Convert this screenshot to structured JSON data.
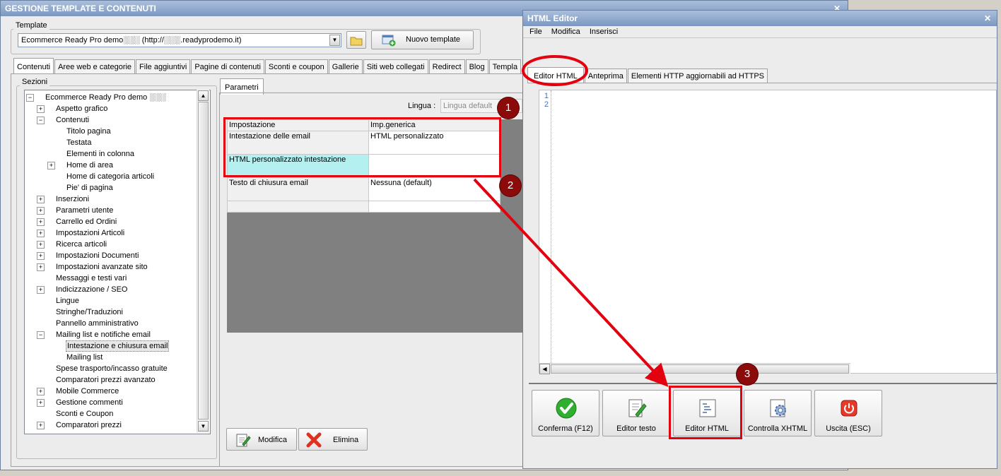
{
  "main": {
    "title": "GESTIONE TEMPLATE E CONTENUTI",
    "template_group_label": "Template",
    "template_select_value": "Ecommerce Ready Pro demo░░░ (http://░░░.readyprodemo.it)",
    "new_template_label": "Nuovo template",
    "tabs": [
      "Contenuti",
      "Aree web e categorie",
      "File aggiuntivi",
      "Pagine di contenuti",
      "Sconti e coupon",
      "Gallerie",
      "Siti web collegati",
      "Redirect",
      "Blog",
      "Templa"
    ],
    "sections_label": "Sezioni",
    "tree": [
      {
        "label": "Ecommerce Ready Pro demo ░░░",
        "level": 0,
        "exp": "−"
      },
      {
        "label": "Aspetto grafico",
        "level": 1,
        "exp": "+"
      },
      {
        "label": "Contenuti",
        "level": 1,
        "exp": "−"
      },
      {
        "label": "Titolo pagina",
        "level": 2,
        "exp": ""
      },
      {
        "label": "Testata",
        "level": 2,
        "exp": ""
      },
      {
        "label": "Elementi in colonna",
        "level": 2,
        "exp": ""
      },
      {
        "label": "Home di area",
        "level": 2,
        "exp": "+"
      },
      {
        "label": "Home di categoria articoli",
        "level": 2,
        "exp": ""
      },
      {
        "label": "Pie' di pagina",
        "level": 2,
        "exp": ""
      },
      {
        "label": "Inserzioni",
        "level": 1,
        "exp": "+"
      },
      {
        "label": "Parametri utente",
        "level": 1,
        "exp": "+"
      },
      {
        "label": "Carrello ed Ordini",
        "level": 1,
        "exp": "+"
      },
      {
        "label": "Impostazioni Articoli",
        "level": 1,
        "exp": "+"
      },
      {
        "label": "Ricerca articoli",
        "level": 1,
        "exp": "+"
      },
      {
        "label": "Impostazioni Documenti",
        "level": 1,
        "exp": "+"
      },
      {
        "label": "Impostazioni avanzate sito",
        "level": 1,
        "exp": "+"
      },
      {
        "label": "Messaggi e testi vari",
        "level": 1,
        "exp": ""
      },
      {
        "label": "Indicizzazione / SEO",
        "level": 1,
        "exp": "+"
      },
      {
        "label": "Lingue",
        "level": 1,
        "exp": ""
      },
      {
        "label": "Stringhe/Traduzioni",
        "level": 1,
        "exp": ""
      },
      {
        "label": "Pannello amministrativo",
        "level": 1,
        "exp": ""
      },
      {
        "label": "Mailing list e notifiche email",
        "level": 1,
        "exp": "−"
      },
      {
        "label": "Intestazione e chiusura email",
        "level": 2,
        "exp": "",
        "selected": true
      },
      {
        "label": "Mailing list",
        "level": 2,
        "exp": ""
      },
      {
        "label": "Spese trasporto/incasso gratuite",
        "level": 1,
        "exp": ""
      },
      {
        "label": "Comparatori prezzi avanzato",
        "level": 1,
        "exp": ""
      },
      {
        "label": "Mobile Commerce",
        "level": 1,
        "exp": "+"
      },
      {
        "label": "Gestione commenti",
        "level": 1,
        "exp": "+"
      },
      {
        "label": "Sconti e Coupon",
        "level": 1,
        "exp": ""
      },
      {
        "label": "Comparatori prezzi",
        "level": 1,
        "exp": "+"
      }
    ],
    "params_tab": "Parametri",
    "lingua_label": "Lingua :",
    "lingua_placeholder": "Lingua default",
    "grid_headers": [
      "Impostazione",
      "Imp.generica"
    ],
    "grid_rows": [
      {
        "name": "Intestazione delle email",
        "value": "HTML personalizzato"
      },
      {
        "name": "HTML personalizzato intestazione",
        "value": "",
        "selected": true
      },
      {
        "name": "Testo di chiusura email",
        "value": "Nessuna (default)"
      }
    ],
    "modifica_label": "Modifica",
    "elimina_label": "Elimina"
  },
  "editor": {
    "title": "HTML Editor",
    "menu": [
      "File",
      "Modifica",
      "Inserisci"
    ],
    "tabs": [
      "Editor HTML",
      "Anteprima",
      "Elementi HTTP aggiornabili ad HTTPS"
    ],
    "line_numbers": [
      "1",
      "2"
    ],
    "buttons": [
      "Conferma (F12)",
      "Editor testo",
      "Editor HTML",
      "Controlla XHTML",
      "Uscita (ESC)"
    ]
  },
  "callouts": [
    "1",
    "2",
    "3"
  ],
  "colors": {
    "annotation_red": "#e3000f",
    "badge": "#8b0a0a",
    "selected_cell": "#b4f0f0",
    "title_bar": "#8aa4cc"
  }
}
